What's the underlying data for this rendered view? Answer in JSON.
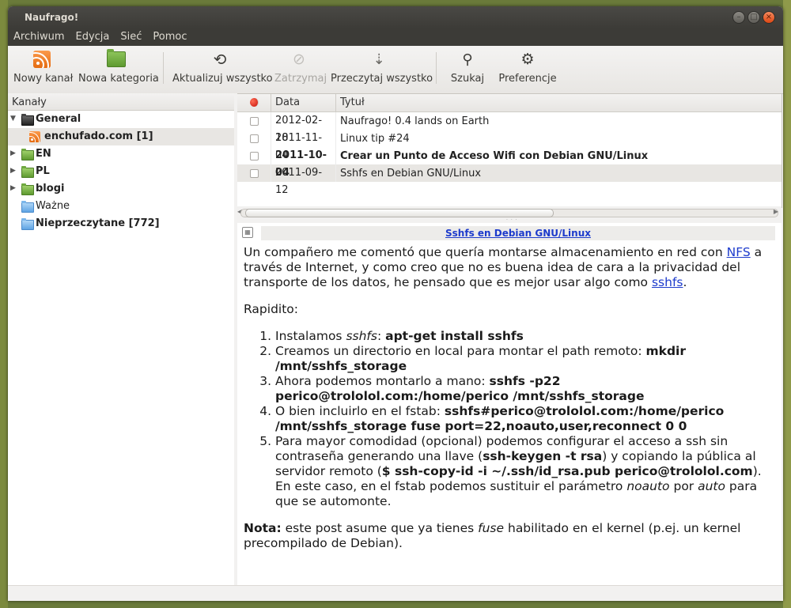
{
  "window": {
    "title": "Naufrago!"
  },
  "menu": [
    "Archiwum",
    "Edycja",
    "Sieć",
    "Pomoc"
  ],
  "toolbar": {
    "new_feed": "Nowy kanał",
    "new_category": "Nowa kategoria",
    "update_all": "Aktualizuj wszystko",
    "stop": "Zatrzymaj",
    "mark_all_read": "Przeczytaj wszystko",
    "search": "Szukaj",
    "preferences": "Preferencje"
  },
  "sidebar": {
    "header": "Kanały",
    "items": [
      {
        "label": "General"
      },
      {
        "label": "enchufado.com [1]"
      },
      {
        "label": "EN"
      },
      {
        "label": "PL"
      },
      {
        "label": "blogi"
      },
      {
        "label": "Ważne"
      },
      {
        "label": "Nieprzeczytane [772]"
      }
    ]
  },
  "list": {
    "headers": {
      "date": "Data",
      "title": "Tytuł"
    },
    "rows": [
      {
        "date": "2012-02-18",
        "title": "Naufrago! 0.4 lands on Earth",
        "bold": false
      },
      {
        "date": "2011-11-04",
        "title": "Linux tip #24",
        "bold": false
      },
      {
        "date": "2011-10-04",
        "title": "Crear un Punto de Acceso Wifi con Debian GNU/Linux",
        "bold": true
      },
      {
        "date": "2011-09-12",
        "title": "Sshfs en Debian GNU/Linux",
        "bold": false
      }
    ]
  },
  "article": {
    "title": "Sshfs en Debian GNU/Linux",
    "p1_a": "Un compañero me comentó que quería montarse almacenamiento en red con ",
    "p1_link1": "NFS",
    "p1_b": " a través de Internet, y como creo que no es buena idea de cara a la privacidad del transporte de los datos, he pensado que es mejor usar algo como ",
    "p1_link2": "sshfs",
    "p1_c": ".",
    "p2": "Rapidito:",
    "li1_a": "Instalamos ",
    "li1_i": "sshfs",
    "li1_b": ": ",
    "li1_cmd": "apt-get install sshfs",
    "li2_a": "Creamos un directorio en local para montar el path remoto: ",
    "li2_cmd": "mkdir /mnt/sshfs_storage",
    "li3_a": "Ahora podemos montarlo a mano: ",
    "li3_cmd": "sshfs -p22 perico@trololol.com:/home/perico /mnt/sshfs_storage",
    "li4_a": "O bien incluirlo en el fstab: ",
    "li4_cmd": "sshfs#perico@trololol.com:/home/perico /mnt/sshfs_storage fuse port=22,noauto,user,reconnect 0 0",
    "li5_a": "Para mayor comodidad (opcional) podemos configurar el acceso a ssh sin contraseña generando una llave (",
    "li5_cmd1": "ssh-keygen -t rsa",
    "li5_b": ") y copiando la pública al servidor remoto (",
    "li5_cmd2": "$ ssh-copy-id -i ~/.ssh/id_rsa.pub perico@trololol.com",
    "li5_c": "). En este caso, en el fstab podemos sustituir el parámetro ",
    "li5_i1": "noauto",
    "li5_d": " por ",
    "li5_i2": "auto",
    "li5_e": " para que se automonte.",
    "note_b": "Nota:",
    "note_a": " este post asume que ya tienes ",
    "note_i": "fuse",
    "note_c": " habilitado en el kernel (p.ej. un kernel precompilado de Debian)."
  }
}
